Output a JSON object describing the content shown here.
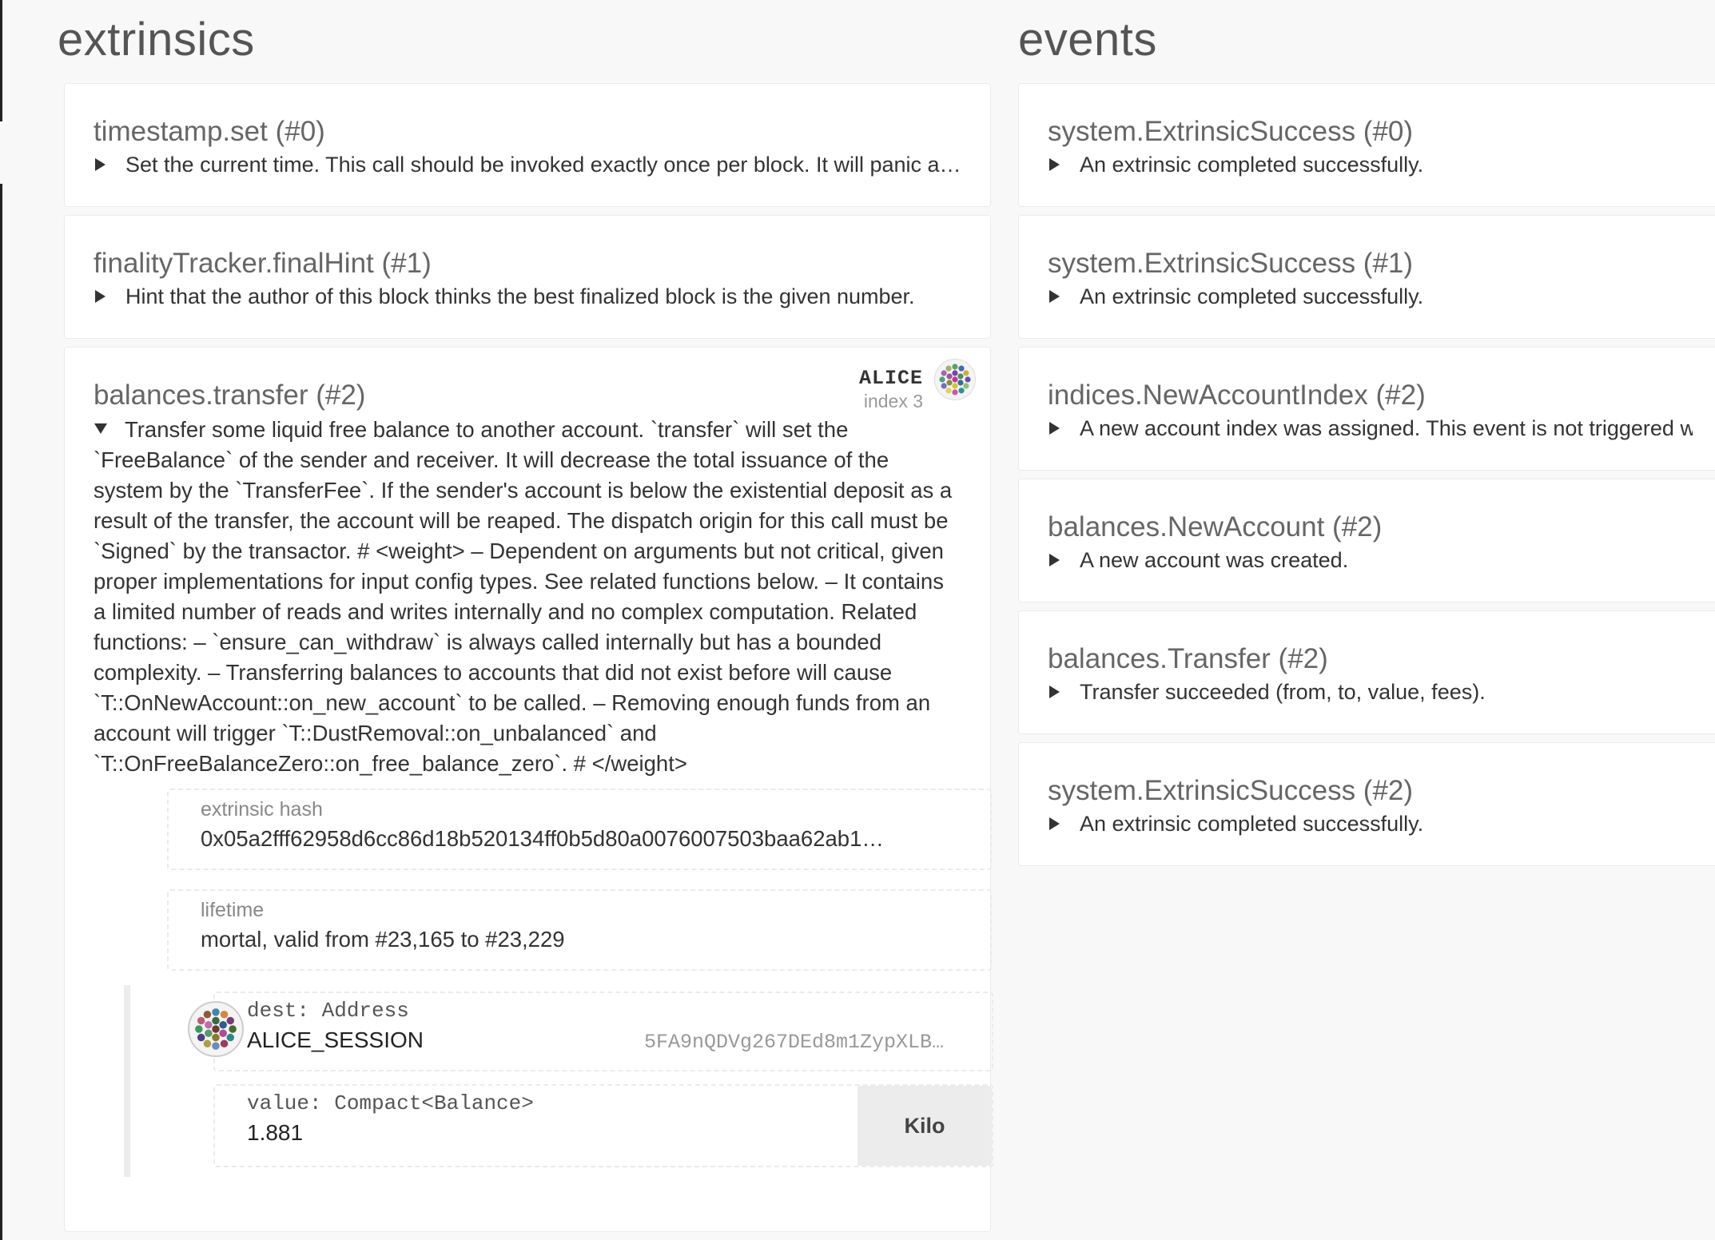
{
  "extrinsics": {
    "title": "extrinsics",
    "items": [
      {
        "title": "timestamp.set (#0)",
        "description": "Set the current time. This call should be invoked exactly once per block. It will panic at the finalization phase, if this call hasn't been invoked by that time."
      },
      {
        "title": "finalityTracker.finalHint (#1)",
        "description": "Hint that the author of this block thinks the best finalized block is the given number."
      }
    ],
    "transfer": {
      "title": "balances.transfer (#2)",
      "signer_name": "ALICE",
      "signer_index": "index 3",
      "description": "Transfer some liquid free balance to another account. `transfer` will set the `FreeBalance` of the sender and receiver. It will decrease the total issuance of the system by the `TransferFee`. If the sender's account is below the existential deposit as a result of the transfer, the account will be reaped. The dispatch origin for this call must be `Signed` by the transactor. # <weight> – Dependent on arguments but not critical, given proper implementations for input config types. See related functions below. – It contains a limited number of reads and writes internally and no complex computation. Related functions: – `ensure_can_withdraw` is always called internally but has a bounded complexity. – Transferring balances to accounts that did not exist before will cause `T::OnNewAccount::on_new_account` to be called. – Removing enough funds from an account will trigger `T::DustRemoval::on_unbalanced` and `T::OnFreeBalanceZero::on_free_balance_zero`. # </weight>",
      "hash_label": "extrinsic hash",
      "hash_value": "0x05a2fff62958d6cc86d18b520134ff0b5d80a0076007503baa62ab1…",
      "lifetime_label": "lifetime",
      "lifetime_value": "mortal, valid from #23,165 to #23,229",
      "dest_label": "dest: Address",
      "dest_name": "ALICE_SESSION",
      "dest_address": "5FA9nQDVg267DEd8m1ZypXLB…",
      "value_label": "value: Compact<Balance>",
      "value_amount": "1.881",
      "value_unit": "Kilo"
    }
  },
  "events": {
    "title": "events",
    "items": [
      {
        "title": "system.ExtrinsicSuccess (#0)",
        "description": "An extrinsic completed successfully."
      },
      {
        "title": "system.ExtrinsicSuccess (#1)",
        "description": "An extrinsic completed successfully."
      },
      {
        "title": "indices.NewAccountIndex (#2)",
        "description": "A new account index was assigned. This event is not triggered when an existing index is reassigned to another AccountId."
      },
      {
        "title": "balances.NewAccount (#2)",
        "description": "A new account was created."
      },
      {
        "title": "balances.Transfer (#2)",
        "description": "Transfer succeeded (from, to, value, fees)."
      },
      {
        "title": "system.ExtrinsicSuccess (#2)",
        "description": "An extrinsic completed successfully."
      }
    ]
  },
  "colors": {
    "identicon_alice": [
      "#c0398f",
      "#7b3fb5",
      "#4a8f5a",
      "#2e6f9e",
      "#d9c23a",
      "#8c8c3a",
      "#a0529f",
      "#5fa05f",
      "#3a6fb0",
      "#cfae3f",
      "#6b4bb0",
      "#8fbf6f",
      "#2f8f8f",
      "#bf5fa0",
      "#e0d060",
      "#7070c0",
      "#50a080",
      "#a06ab0",
      "#9fb06f"
    ],
    "identicon_session": [
      "#6a3b2a",
      "#3a6a3a",
      "#2b5e8c",
      "#b04a9a",
      "#8a7a2a",
      "#5a9a6a",
      "#c06ab0",
      "#3a8ab0",
      "#d08a3a",
      "#7a3a7a",
      "#4a6a2a",
      "#2a8a8a",
      "#a03a5a",
      "#6a8ac0",
      "#b0a03a",
      "#503a8a",
      "#3a9a5a",
      "#c05a7a",
      "#8a5a3a"
    ]
  }
}
